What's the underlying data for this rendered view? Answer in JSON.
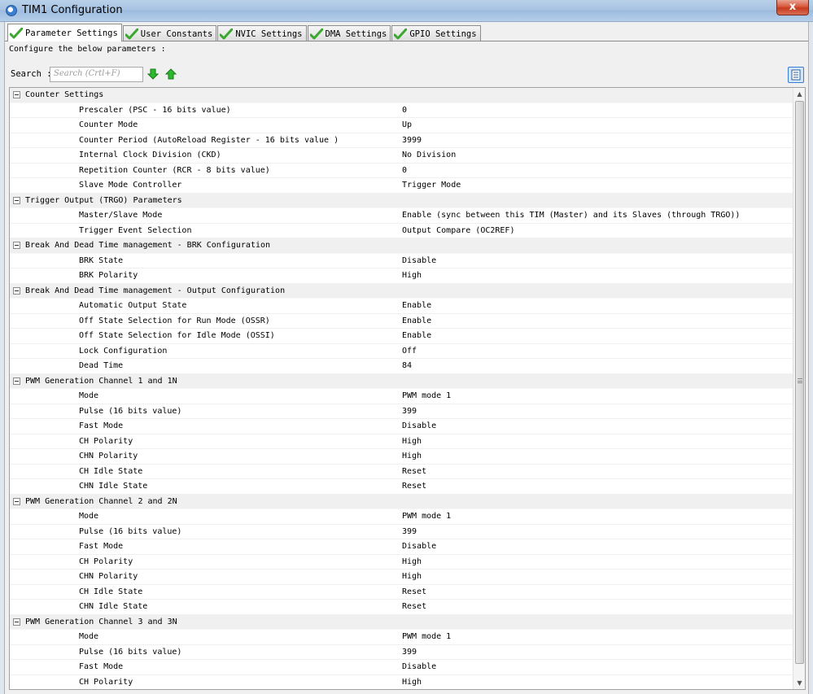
{
  "window": {
    "title": "TIM1 Configuration",
    "close_label": "x"
  },
  "tabs": [
    {
      "label": "Parameter Settings",
      "active": true
    },
    {
      "label": "User Constants",
      "active": false
    },
    {
      "label": "NVIC Settings",
      "active": false
    },
    {
      "label": "DMA Settings",
      "active": false
    },
    {
      "label": "GPIO Settings",
      "active": false
    }
  ],
  "intro": "Configure the below parameters :",
  "search": {
    "label": "Search :",
    "placeholder": "Search (Crtl+F)"
  },
  "groups": [
    {
      "name": "Counter Settings",
      "props": [
        [
          "Prescaler (PSC - 16 bits value)",
          "0"
        ],
        [
          "Counter Mode",
          "Up"
        ],
        [
          "Counter Period (AutoReload Register - 16 bits value )",
          "3999"
        ],
        [
          "Internal Clock Division (CKD)",
          "No Division"
        ],
        [
          "Repetition Counter (RCR - 8 bits value)",
          "0"
        ],
        [
          "Slave Mode Controller",
          "Trigger Mode"
        ]
      ]
    },
    {
      "name": "Trigger Output (TRGO) Parameters",
      "props": [
        [
          "Master/Slave Mode",
          "Enable (sync between this TIM (Master) and its Slaves (through TRGO))"
        ],
        [
          "Trigger Event Selection",
          "Output Compare (OC2REF)"
        ]
      ]
    },
    {
      "name": "Break And Dead Time management - BRK Configuration",
      "props": [
        [
          "BRK State",
          "Disable"
        ],
        [
          "BRK Polarity",
          "High"
        ]
      ]
    },
    {
      "name": "Break And Dead Time management - Output Configuration",
      "props": [
        [
          "Automatic Output State",
          "Enable"
        ],
        [
          "Off State Selection for Run Mode (OSSR)",
          "Enable"
        ],
        [
          "Off State Selection for Idle Mode (OSSI)",
          "Enable"
        ],
        [
          "Lock Configuration",
          "Off"
        ],
        [
          "Dead Time",
          "84"
        ]
      ]
    },
    {
      "name": "PWM Generation Channel 1 and 1N",
      "props": [
        [
          "Mode",
          "PWM mode 1"
        ],
        [
          "Pulse (16 bits value)",
          "399"
        ],
        [
          "Fast Mode",
          "Disable"
        ],
        [
          "CH Polarity",
          "High"
        ],
        [
          "CHN Polarity",
          "High"
        ],
        [
          "CH Idle State",
          "Reset"
        ],
        [
          "CHN Idle State",
          "Reset"
        ]
      ]
    },
    {
      "name": "PWM Generation Channel 2 and 2N",
      "props": [
        [
          "Mode",
          "PWM mode 1"
        ],
        [
          "Pulse (16 bits value)",
          "399"
        ],
        [
          "Fast Mode",
          "Disable"
        ],
        [
          "CH Polarity",
          "High"
        ],
        [
          "CHN Polarity",
          "High"
        ],
        [
          "CH Idle State",
          "Reset"
        ],
        [
          "CHN Idle State",
          "Reset"
        ]
      ]
    },
    {
      "name": "PWM Generation Channel 3 and 3N",
      "props": [
        [
          "Mode",
          "PWM mode 1"
        ],
        [
          "Pulse (16 bits value)",
          "399"
        ],
        [
          "Fast Mode",
          "Disable"
        ],
        [
          "CH Polarity",
          "High"
        ]
      ]
    }
  ],
  "icons": {
    "tab_check": "check-icon",
    "search_next": "arrow-down-icon",
    "search_prev": "arrow-up-icon",
    "expand_all": "list-icon",
    "group_toggle": "collapse-icon"
  },
  "colors": {
    "check_green": "#3aa82e",
    "arrow_green": "#2eb82e",
    "group_bg": "#f0f0f0",
    "titlebar": "#b9d1ea"
  }
}
